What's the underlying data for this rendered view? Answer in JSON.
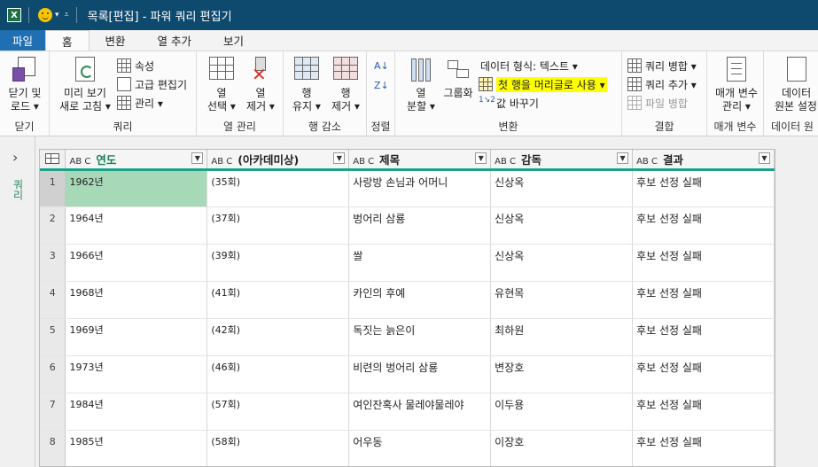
{
  "window": {
    "app_icon": "excel-icon",
    "title": "목록[편집] - 파워 쿼리 편집기"
  },
  "tabs": [
    "파일",
    "홈",
    "변환",
    "열 추가",
    "보기"
  ],
  "active_tab": "홈",
  "ribbon": {
    "close": {
      "btn_line1": "닫기 및",
      "btn_line2": "로드 ▾",
      "label": "닫기"
    },
    "query": {
      "refresh_line1": "미리 보기",
      "refresh_line2": "새로 고침 ▾",
      "properties": "속성",
      "advanced_editor": "고급 편집기",
      "manage": "관리 ▾",
      "label": "쿼리"
    },
    "columns": {
      "choose_line1": "열",
      "choose_line2": "선택 ▾",
      "remove_line1": "열",
      "remove_line2": "제거 ▾",
      "label": "열 관리"
    },
    "rows": {
      "keep_line1": "행",
      "keep_line2": "유지 ▾",
      "remove_line1": "행",
      "remove_line2": "제거 ▾",
      "label": "행 감소"
    },
    "sort": {
      "label": "정렬"
    },
    "transform": {
      "split_line1": "열",
      "split_line2": "분할 ▾",
      "group_by": "그룹화",
      "data_type": "데이터 형식: 텍스트 ▾",
      "first_row_header": "첫 행을 머리글로 사용 ▾",
      "replace_values": "값 바꾸기",
      "label": "변환"
    },
    "combine": {
      "merge": "쿼리 병합 ▾",
      "append": "쿼리 추가 ▾",
      "combine_files": "파일 병합",
      "label": "결합"
    },
    "params": {
      "btn_line1": "매개 변수",
      "btn_line2": "관리 ▾",
      "label": "매개 변수"
    },
    "datasource": {
      "btn_line1": "데이터",
      "btn_line2": "원본 설정",
      "label": "데이터 원"
    }
  },
  "left_pane": {
    "label": "쿼리"
  },
  "table": {
    "type_prefix": "AB C",
    "columns": [
      "연도",
      "(아카데미상)",
      "제목",
      "감독",
      "결과"
    ],
    "rows": [
      {
        "n": "1",
        "cells": [
          "1962년",
          "(35회)",
          "사랑방 손님과 어머니",
          "신상옥",
          "후보 선정 실패"
        ]
      },
      {
        "n": "2",
        "cells": [
          "1964년",
          "(37회)",
          "벙어리 삼룡",
          "신상옥",
          "후보 선정 실패"
        ]
      },
      {
        "n": "3",
        "cells": [
          "1966년",
          "(39회)",
          "쌀",
          "신상옥",
          "후보 선정 실패"
        ]
      },
      {
        "n": "4",
        "cells": [
          "1968년",
          "(41회)",
          "카인의 후예",
          "유현목",
          "후보 선정 실패"
        ]
      },
      {
        "n": "5",
        "cells": [
          "1969년",
          "(42회)",
          "독짓는 늙은이",
          "최하원",
          "후보 선정 실패"
        ]
      },
      {
        "n": "6",
        "cells": [
          "1973년",
          "(46회)",
          "비련의 벙어리 삼룡",
          "변장호",
          "후보 선정 실패"
        ]
      },
      {
        "n": "7",
        "cells": [
          "1984년",
          "(57회)",
          "여인잔혹사 물레야물레야",
          "이두용",
          "후보 선정 실패"
        ]
      },
      {
        "n": "8",
        "cells": [
          "1985년",
          "(58회)",
          "어우동",
          "이장호",
          "후보 선정 실패"
        ]
      }
    ]
  },
  "colors": {
    "titlebar": "#0e4a6e",
    "file_tab": "#1f6fb2",
    "header_accent": "#1aa38a",
    "selected_cell": "#a7d8b8",
    "highlight": "#ffff00"
  }
}
